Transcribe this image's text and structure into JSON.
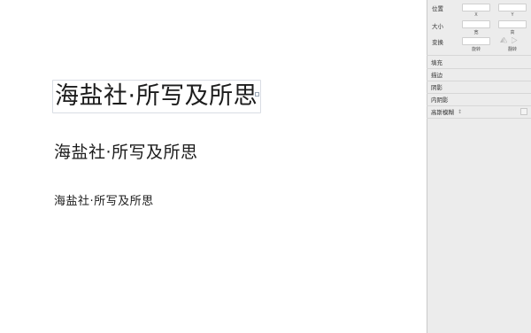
{
  "canvas": {
    "text_large": "海盐社·所写及所思",
    "text_medium": "海盐社·所写及所思",
    "text_small": "海盐社·所写及所思"
  },
  "inspector": {
    "position": {
      "label": "位置",
      "x_caption": "X",
      "y_caption": "Y"
    },
    "size": {
      "label": "大小",
      "width_caption": "宽",
      "height_caption": "高"
    },
    "transform": {
      "label": "变换",
      "rotate_caption": "旋转",
      "flip_caption": "翻转"
    },
    "sections": [
      {
        "label": "填充"
      },
      {
        "label": "描边"
      },
      {
        "label": "阴影"
      },
      {
        "label": "内阴影"
      },
      {
        "label": "高斯模糊"
      }
    ]
  }
}
